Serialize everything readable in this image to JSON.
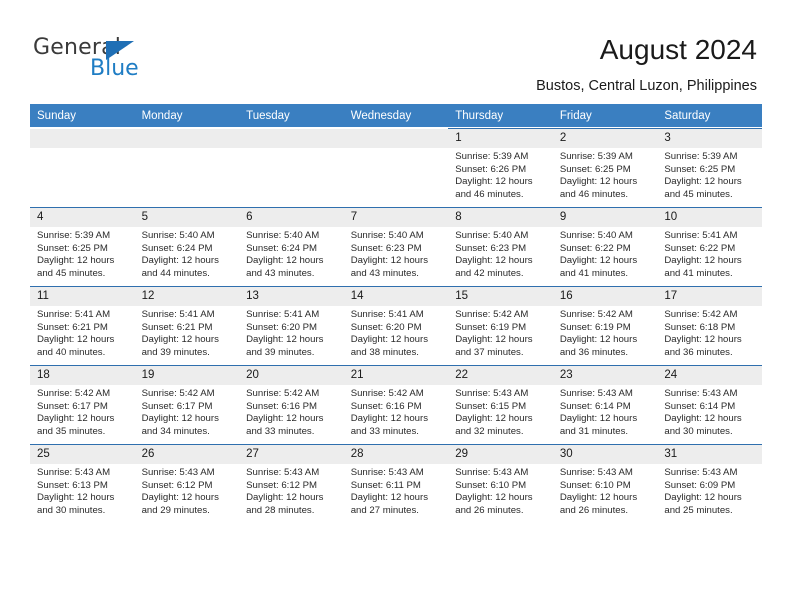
{
  "brand": {
    "name_part1": "General",
    "name_part2": "Blue",
    "triangle_icon": "triangle-icon",
    "colors": {
      "blue": "#1f7dc4",
      "dark": "#3a3a3a",
      "header_blue": "#3a7fc1"
    }
  },
  "header": {
    "title": "August 2024",
    "subtitle": "Bustos, Central Luzon, Philippines"
  },
  "calendar": {
    "weekdays": [
      "Sunday",
      "Monday",
      "Tuesday",
      "Wednesday",
      "Thursday",
      "Friday",
      "Saturday"
    ],
    "labels": {
      "sunrise": "Sunrise:",
      "sunset": "Sunset:",
      "daylight": "Daylight:"
    },
    "weeks": [
      [
        {
          "blank": true
        },
        {
          "blank": true
        },
        {
          "blank": true
        },
        {
          "blank": true
        },
        {
          "day": "1",
          "sunrise": "Sunrise: 5:39 AM",
          "sunset": "Sunset: 6:26 PM",
          "daylight_line1": "Daylight: 12 hours",
          "daylight_line2": "and 46 minutes."
        },
        {
          "day": "2",
          "sunrise": "Sunrise: 5:39 AM",
          "sunset": "Sunset: 6:25 PM",
          "daylight_line1": "Daylight: 12 hours",
          "daylight_line2": "and 46 minutes."
        },
        {
          "day": "3",
          "sunrise": "Sunrise: 5:39 AM",
          "sunset": "Sunset: 6:25 PM",
          "daylight_line1": "Daylight: 12 hours",
          "daylight_line2": "and 45 minutes."
        }
      ],
      [
        {
          "day": "4",
          "sunrise": "Sunrise: 5:39 AM",
          "sunset": "Sunset: 6:25 PM",
          "daylight_line1": "Daylight: 12 hours",
          "daylight_line2": "and 45 minutes."
        },
        {
          "day": "5",
          "sunrise": "Sunrise: 5:40 AM",
          "sunset": "Sunset: 6:24 PM",
          "daylight_line1": "Daylight: 12 hours",
          "daylight_line2": "and 44 minutes."
        },
        {
          "day": "6",
          "sunrise": "Sunrise: 5:40 AM",
          "sunset": "Sunset: 6:24 PM",
          "daylight_line1": "Daylight: 12 hours",
          "daylight_line2": "and 43 minutes."
        },
        {
          "day": "7",
          "sunrise": "Sunrise: 5:40 AM",
          "sunset": "Sunset: 6:23 PM",
          "daylight_line1": "Daylight: 12 hours",
          "daylight_line2": "and 43 minutes."
        },
        {
          "day": "8",
          "sunrise": "Sunrise: 5:40 AM",
          "sunset": "Sunset: 6:23 PM",
          "daylight_line1": "Daylight: 12 hours",
          "daylight_line2": "and 42 minutes."
        },
        {
          "day": "9",
          "sunrise": "Sunrise: 5:40 AM",
          "sunset": "Sunset: 6:22 PM",
          "daylight_line1": "Daylight: 12 hours",
          "daylight_line2": "and 41 minutes."
        },
        {
          "day": "10",
          "sunrise": "Sunrise: 5:41 AM",
          "sunset": "Sunset: 6:22 PM",
          "daylight_line1": "Daylight: 12 hours",
          "daylight_line2": "and 41 minutes."
        }
      ],
      [
        {
          "day": "11",
          "sunrise": "Sunrise: 5:41 AM",
          "sunset": "Sunset: 6:21 PM",
          "daylight_line1": "Daylight: 12 hours",
          "daylight_line2": "and 40 minutes."
        },
        {
          "day": "12",
          "sunrise": "Sunrise: 5:41 AM",
          "sunset": "Sunset: 6:21 PM",
          "daylight_line1": "Daylight: 12 hours",
          "daylight_line2": "and 39 minutes."
        },
        {
          "day": "13",
          "sunrise": "Sunrise: 5:41 AM",
          "sunset": "Sunset: 6:20 PM",
          "daylight_line1": "Daylight: 12 hours",
          "daylight_line2": "and 39 minutes."
        },
        {
          "day": "14",
          "sunrise": "Sunrise: 5:41 AM",
          "sunset": "Sunset: 6:20 PM",
          "daylight_line1": "Daylight: 12 hours",
          "daylight_line2": "and 38 minutes."
        },
        {
          "day": "15",
          "sunrise": "Sunrise: 5:42 AM",
          "sunset": "Sunset: 6:19 PM",
          "daylight_line1": "Daylight: 12 hours",
          "daylight_line2": "and 37 minutes."
        },
        {
          "day": "16",
          "sunrise": "Sunrise: 5:42 AM",
          "sunset": "Sunset: 6:19 PM",
          "daylight_line1": "Daylight: 12 hours",
          "daylight_line2": "and 36 minutes."
        },
        {
          "day": "17",
          "sunrise": "Sunrise: 5:42 AM",
          "sunset": "Sunset: 6:18 PM",
          "daylight_line1": "Daylight: 12 hours",
          "daylight_line2": "and 36 minutes."
        }
      ],
      [
        {
          "day": "18",
          "sunrise": "Sunrise: 5:42 AM",
          "sunset": "Sunset: 6:17 PM",
          "daylight_line1": "Daylight: 12 hours",
          "daylight_line2": "and 35 minutes."
        },
        {
          "day": "19",
          "sunrise": "Sunrise: 5:42 AM",
          "sunset": "Sunset: 6:17 PM",
          "daylight_line1": "Daylight: 12 hours",
          "daylight_line2": "and 34 minutes."
        },
        {
          "day": "20",
          "sunrise": "Sunrise: 5:42 AM",
          "sunset": "Sunset: 6:16 PM",
          "daylight_line1": "Daylight: 12 hours",
          "daylight_line2": "and 33 minutes."
        },
        {
          "day": "21",
          "sunrise": "Sunrise: 5:42 AM",
          "sunset": "Sunset: 6:16 PM",
          "daylight_line1": "Daylight: 12 hours",
          "daylight_line2": "and 33 minutes."
        },
        {
          "day": "22",
          "sunrise": "Sunrise: 5:43 AM",
          "sunset": "Sunset: 6:15 PM",
          "daylight_line1": "Daylight: 12 hours",
          "daylight_line2": "and 32 minutes."
        },
        {
          "day": "23",
          "sunrise": "Sunrise: 5:43 AM",
          "sunset": "Sunset: 6:14 PM",
          "daylight_line1": "Daylight: 12 hours",
          "daylight_line2": "and 31 minutes."
        },
        {
          "day": "24",
          "sunrise": "Sunrise: 5:43 AM",
          "sunset": "Sunset: 6:14 PM",
          "daylight_line1": "Daylight: 12 hours",
          "daylight_line2": "and 30 minutes."
        }
      ],
      [
        {
          "day": "25",
          "sunrise": "Sunrise: 5:43 AM",
          "sunset": "Sunset: 6:13 PM",
          "daylight_line1": "Daylight: 12 hours",
          "daylight_line2": "and 30 minutes."
        },
        {
          "day": "26",
          "sunrise": "Sunrise: 5:43 AM",
          "sunset": "Sunset: 6:12 PM",
          "daylight_line1": "Daylight: 12 hours",
          "daylight_line2": "and 29 minutes."
        },
        {
          "day": "27",
          "sunrise": "Sunrise: 5:43 AM",
          "sunset": "Sunset: 6:12 PM",
          "daylight_line1": "Daylight: 12 hours",
          "daylight_line2": "and 28 minutes."
        },
        {
          "day": "28",
          "sunrise": "Sunrise: 5:43 AM",
          "sunset": "Sunset: 6:11 PM",
          "daylight_line1": "Daylight: 12 hours",
          "daylight_line2": "and 27 minutes."
        },
        {
          "day": "29",
          "sunrise": "Sunrise: 5:43 AM",
          "sunset": "Sunset: 6:10 PM",
          "daylight_line1": "Daylight: 12 hours",
          "daylight_line2": "and 26 minutes."
        },
        {
          "day": "30",
          "sunrise": "Sunrise: 5:43 AM",
          "sunset": "Sunset: 6:10 PM",
          "daylight_line1": "Daylight: 12 hours",
          "daylight_line2": "and 26 minutes."
        },
        {
          "day": "31",
          "sunrise": "Sunrise: 5:43 AM",
          "sunset": "Sunset: 6:09 PM",
          "daylight_line1": "Daylight: 12 hours",
          "daylight_line2": "and 25 minutes."
        }
      ]
    ]
  }
}
